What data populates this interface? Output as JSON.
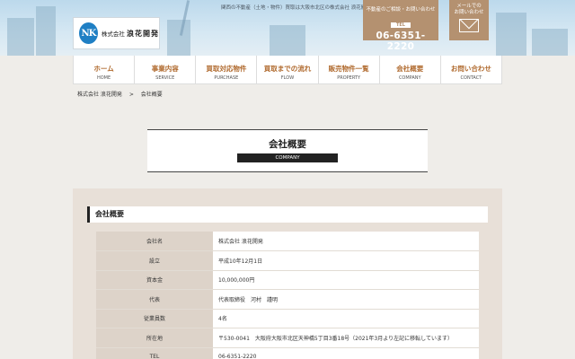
{
  "header": {
    "logo_mark": "NK",
    "logo_small": "株式会社",
    "logo_name": "浪花開発",
    "tagline": "関西の不動産（土地・物件）買取は大阪市北区の株式会社 浪花開発",
    "tel_caption": "不動産のご相談・お問い合わせ",
    "tel_label": "TEL",
    "tel_number": "06-6351-2220",
    "mail_caption_1": "メールでの",
    "mail_caption_2": "お問い合わせ",
    "mail_icon": "envelope-icon"
  },
  "nav": [
    {
      "jp": "ホーム",
      "en": "HOME"
    },
    {
      "jp": "事業内容",
      "en": "SERVICE"
    },
    {
      "jp": "買取対応物件",
      "en": "PURCHASE"
    },
    {
      "jp": "買取までの流れ",
      "en": "FLOW"
    },
    {
      "jp": "販売物件一覧",
      "en": "PROPERTY"
    },
    {
      "jp": "会社概要",
      "en": "COMPANY"
    },
    {
      "jp": "お問い合わせ",
      "en": "CONTACT"
    }
  ],
  "breadcrumb": {
    "home": "株式会社 浪花開発",
    "sep": ">",
    "current": "会社概要"
  },
  "title": {
    "jp": "会社概要",
    "en": "COMPANY"
  },
  "section": {
    "heading": "会社概要",
    "rows": [
      {
        "label": "会社名",
        "value": "株式会社 浪花開発"
      },
      {
        "label": "設立",
        "value": "平成10年12月1日"
      },
      {
        "label": "資本金",
        "value": "10,000,000円"
      },
      {
        "label": "代表",
        "value": "代表取締役　河村　謹明"
      },
      {
        "label": "従業員数",
        "value": "4名"
      },
      {
        "label": "所在地",
        "value": "〒530-0041　大阪府大阪市北区天神橋5丁目3番18号（2021年3月より左記に移転しています）"
      },
      {
        "label": "TEL",
        "value": "06-6351-2220"
      }
    ]
  },
  "colors": {
    "accent": "#b49170",
    "nav_text": "#b06a2e",
    "section_bg": "#e8e0d8"
  }
}
